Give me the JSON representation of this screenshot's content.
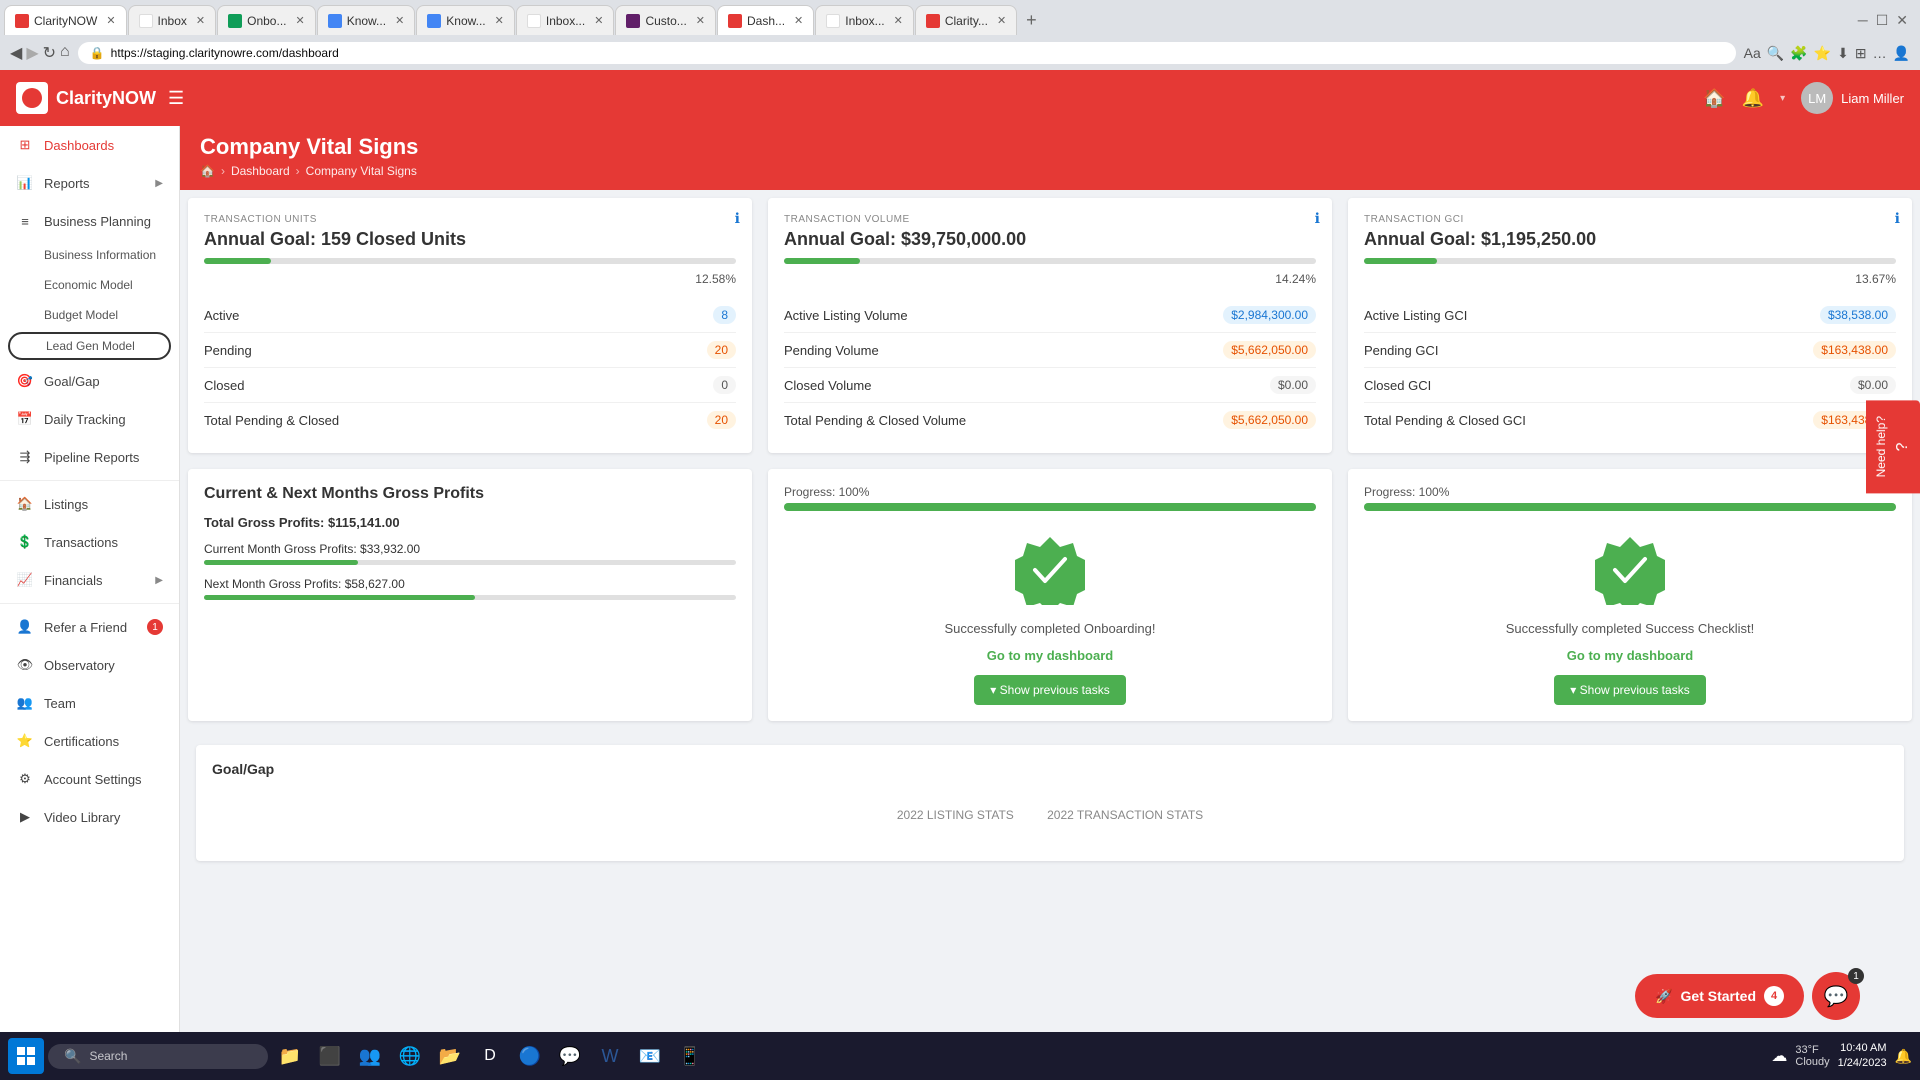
{
  "browser": {
    "url": "https://staging.claritynowre.com/dashboard",
    "tabs": [
      {
        "label": "ClarityNOW",
        "type": "claritynow",
        "active": true
      },
      {
        "label": "Inbox",
        "type": "gmail",
        "active": false
      },
      {
        "label": "Onbo...",
        "type": "sheets",
        "active": false
      },
      {
        "label": "Know...",
        "type": "docs",
        "active": false
      },
      {
        "label": "Know...",
        "type": "docs",
        "active": false
      },
      {
        "label": "Inbox...",
        "type": "inbox",
        "active": false
      },
      {
        "label": "Custo...",
        "type": "slack",
        "active": false
      },
      {
        "label": "Dash...",
        "type": "claritynow",
        "active": true
      },
      {
        "label": "Inbox...",
        "type": "gmail",
        "active": false
      },
      {
        "label": "Clarity...",
        "type": "claritynow",
        "active": false
      }
    ]
  },
  "header": {
    "logo_text": "ClarityNOW",
    "home_icon": "🏠",
    "bell_icon": "🔔",
    "user_name": "Liam Miller"
  },
  "sidebar": {
    "items": [
      {
        "label": "Dashboards",
        "icon": "grid",
        "active": true
      },
      {
        "label": "Reports",
        "icon": "bar-chart",
        "has_arrow": true
      },
      {
        "label": "Business Planning",
        "icon": "list",
        "has_arrow": false
      },
      {
        "label": "Business Information",
        "sub": true
      },
      {
        "label": "Economic Model",
        "sub": true
      },
      {
        "label": "Budget Model",
        "sub": true
      },
      {
        "label": "Lead Gen Model",
        "sub": true,
        "circled": true
      },
      {
        "label": "Goal/Gap",
        "icon": "target"
      },
      {
        "label": "Daily Tracking",
        "icon": "calendar"
      },
      {
        "label": "Pipeline Reports",
        "icon": "pipeline"
      },
      {
        "label": "Listings",
        "icon": "home"
      },
      {
        "label": "Transactions",
        "icon": "dollar"
      },
      {
        "label": "Financials",
        "icon": "chart",
        "has_arrow": true
      },
      {
        "label": "Refer a Friend",
        "icon": "person",
        "badge": "1"
      },
      {
        "label": "Observatory",
        "icon": "eye"
      },
      {
        "label": "Team",
        "icon": "group"
      },
      {
        "label": "Certifications",
        "icon": "star"
      },
      {
        "label": "Account Settings",
        "icon": "gear"
      },
      {
        "label": "Video Library",
        "icon": "video"
      }
    ]
  },
  "page": {
    "title": "Company Vital Signs",
    "breadcrumb_home": "🏠",
    "breadcrumb_dashboard": "Dashboard",
    "breadcrumb_current": "Company Vital Signs"
  },
  "transaction_units": {
    "header_label": "TRANSACTION UNITS",
    "title": "Annual Goal: 159 Closed Units",
    "progress_pct": "12.58%",
    "progress_width": "12.58",
    "metrics": [
      {
        "label": "Active",
        "value": "8",
        "color": "blue"
      },
      {
        "label": "Pending",
        "value": "20",
        "color": "orange"
      },
      {
        "label": "Closed",
        "value": "0",
        "color": "gray"
      },
      {
        "label": "Total Pending & Closed",
        "value": "20",
        "color": "orange"
      }
    ]
  },
  "transaction_volume": {
    "header_label": "TRANSACTION VOLUME",
    "title": "Annual Goal: $39,750,000.00",
    "progress_pct": "14.24%",
    "progress_width": "14.24",
    "metrics": [
      {
        "label": "Active Listing Volume",
        "value": "$2,984,300.00",
        "color": "blue"
      },
      {
        "label": "Pending Volume",
        "value": "$5,662,050.00",
        "color": "orange"
      },
      {
        "label": "Closed Volume",
        "value": "$0.00",
        "color": "gray"
      },
      {
        "label": "Total Pending & Closed Volume",
        "value": "$5,662,050.00",
        "color": "orange"
      }
    ]
  },
  "transaction_gci": {
    "header_label": "TRANSACTION GCI",
    "title": "Annual Goal: $1,195,250.00",
    "progress_pct": "13.67%",
    "progress_width": "13.67",
    "metrics": [
      {
        "label": "Active Listing GCI",
        "value": "$38,538.00",
        "color": "blue"
      },
      {
        "label": "Pending GCI",
        "value": "$163,438.00",
        "color": "orange"
      },
      {
        "label": "Closed GCI",
        "value": "$0.00",
        "color": "gray"
      },
      {
        "label": "Total Pending & Closed GCI",
        "value": "$163,438.00",
        "color": "orange"
      }
    ]
  },
  "gross_profits": {
    "title": "Current & Next Months Gross Profits",
    "total": "Total Gross Profits: $115,141.00",
    "current_label": "Current Month Gross Profits: $33,932.00",
    "current_pct": 29,
    "next_label": "Next Month Gross Profits: $58,627.00",
    "next_pct": 51
  },
  "onboarding": {
    "progress_label": "Progress: 100%",
    "progress_width": "100",
    "completion_text": "Successfully completed Onboarding!",
    "link_text": "Go to my dashboard",
    "show_prev_label": "▾ Show previous tasks"
  },
  "success_checklist": {
    "progress_label": "Progress: 100%",
    "progress_width": "100",
    "completion_text": "Successfully completed Success Checklist!",
    "link_text": "Go to my dashboard",
    "show_prev_label": "▾ Show previous tasks"
  },
  "goal_gap": {
    "title": "Goal/Gap"
  },
  "need_help": {
    "label": "Need help?"
  },
  "taskbar": {
    "search_text": "Search",
    "time": "10:40 AM",
    "date": "1/24/2023",
    "weather": "33°F",
    "weather_desc": "Cloudy"
  }
}
